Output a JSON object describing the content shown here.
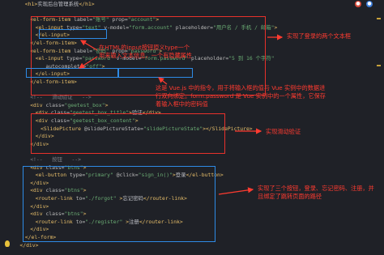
{
  "editor": {
    "lines": [
      {
        "indent": 4,
        "parts": [
          [
            "tag",
            "<h1>"
          ],
          [
            "punc",
            "实现后台管理系统"
          ],
          [
            "tag",
            "</h1>"
          ]
        ]
      },
      {
        "indent": 0,
        "parts": []
      },
      {
        "indent": 6,
        "parts": [
          [
            "tag",
            "<el-form-item "
          ],
          [
            "attr",
            "label="
          ],
          [
            "val",
            "\"账号\""
          ],
          [
            "attr",
            " prop="
          ],
          [
            "val",
            "\"account\""
          ],
          [
            "tag",
            ">"
          ]
        ]
      },
      {
        "indent": 8,
        "parts": [
          [
            "tag",
            "<el-input "
          ],
          [
            "attr",
            "type="
          ],
          [
            "val",
            "\"text\""
          ],
          [
            "attr",
            " v-model="
          ],
          [
            "val",
            "\"form.account\""
          ],
          [
            "attr",
            " placeholder="
          ],
          [
            "val",
            "\"用户名 / 手机 / 邮箱\""
          ],
          [
            "tag",
            ">"
          ]
        ]
      },
      {
        "indent": 8,
        "parts": [
          [
            "tag",
            "</el-input>"
          ]
        ]
      },
      {
        "indent": 6,
        "parts": [
          [
            "tag",
            "</el-form-item>"
          ]
        ]
      },
      {
        "indent": 6,
        "parts": [
          [
            "tag",
            "<el-form-item "
          ],
          [
            "attr",
            "label="
          ],
          [
            "val",
            "\"密码\""
          ],
          [
            "attr",
            " prop="
          ],
          [
            "val",
            "\"password\""
          ],
          [
            "tag",
            ">"
          ]
        ]
      },
      {
        "indent": 8,
        "parts": [
          [
            "tag",
            "<el-input "
          ],
          [
            "attr",
            "type="
          ],
          [
            "val",
            "\"password\""
          ],
          [
            "attr",
            " v-model="
          ],
          [
            "val",
            "\"form.password\""
          ],
          [
            "attr",
            " placeholder="
          ],
          [
            "val",
            "\"5 到 16 个字符\""
          ]
        ]
      },
      {
        "indent": 12,
        "parts": [
          [
            "attr",
            "autocomplete="
          ],
          [
            "val",
            "\"off\""
          ],
          [
            "tag",
            ">"
          ]
        ]
      },
      {
        "indent": 8,
        "parts": [
          [
            "tag",
            "</el-input>"
          ]
        ]
      },
      {
        "indent": 6,
        "parts": [
          [
            "tag",
            "</el-form-item>"
          ]
        ]
      },
      {
        "indent": 0,
        "parts": []
      },
      {
        "indent": 6,
        "parts": [
          [
            "cmt",
            "<!--   滑动验证   -->"
          ]
        ]
      },
      {
        "indent": 6,
        "parts": [
          [
            "tag",
            "<div "
          ],
          [
            "attr",
            "class="
          ],
          [
            "val",
            "\"geetest_box\""
          ],
          [
            "tag",
            ">"
          ]
        ]
      },
      {
        "indent": 8,
        "parts": [
          [
            "tag",
            "<div "
          ],
          [
            "attr",
            "class="
          ],
          [
            "val",
            "\"geetest_box_title\""
          ],
          [
            "tag",
            ">"
          ],
          [
            "punc",
            "验证"
          ],
          [
            "tag",
            "</div>"
          ]
        ]
      },
      {
        "indent": 8,
        "parts": [
          [
            "tag",
            "<div "
          ],
          [
            "attr",
            "class="
          ],
          [
            "val",
            "\"geetest_box_content\""
          ],
          [
            "tag",
            ">"
          ]
        ]
      },
      {
        "indent": 10,
        "parts": [
          [
            "tag",
            "<SlidePicture "
          ],
          [
            "attr",
            "@slidePictureState="
          ],
          [
            "val",
            "\"slidePictureState\""
          ],
          [
            "tag",
            "></SlidePicture>"
          ]
        ]
      },
      {
        "indent": 8,
        "parts": [
          [
            "tag",
            "</div>"
          ]
        ]
      },
      {
        "indent": 6,
        "parts": [
          [
            "tag",
            "</div>"
          ]
        ]
      },
      {
        "indent": 0,
        "parts": []
      },
      {
        "indent": 6,
        "parts": [
          [
            "cmt",
            "<!--   按钮   -->"
          ]
        ]
      },
      {
        "indent": 6,
        "parts": [
          [
            "tag",
            "<div "
          ],
          [
            "attr",
            "class="
          ],
          [
            "val",
            "\"btns\""
          ],
          [
            "tag",
            ">"
          ]
        ]
      },
      {
        "indent": 8,
        "parts": [
          [
            "tag",
            "<el-button "
          ],
          [
            "attr",
            "type="
          ],
          [
            "val",
            "\"primary\""
          ],
          [
            "attr",
            " @click="
          ],
          [
            "val",
            "\"sign_in()\""
          ],
          [
            "tag",
            ">"
          ],
          [
            "punc",
            "登录"
          ],
          [
            "tag",
            "</el-button>"
          ]
        ]
      },
      {
        "indent": 6,
        "parts": [
          [
            "tag",
            "</div>"
          ]
        ]
      },
      {
        "indent": 6,
        "parts": [
          [
            "tag",
            "<div "
          ],
          [
            "attr",
            "class="
          ],
          [
            "val",
            "\"btns\""
          ],
          [
            "tag",
            ">"
          ]
        ]
      },
      {
        "indent": 8,
        "parts": [
          [
            "tag",
            "<router-link "
          ],
          [
            "attr",
            "to="
          ],
          [
            "val",
            "\"./forgot\""
          ],
          [
            "tag",
            " >"
          ],
          [
            "punc",
            "忘记密码"
          ],
          [
            "tag",
            "</router-link>"
          ]
        ]
      },
      {
        "indent": 6,
        "parts": [
          [
            "tag",
            "</div>"
          ]
        ]
      },
      {
        "indent": 6,
        "parts": [
          [
            "tag",
            "<div "
          ],
          [
            "attr",
            "class="
          ],
          [
            "val",
            "\"btns\""
          ],
          [
            "tag",
            ">"
          ]
        ]
      },
      {
        "indent": 8,
        "parts": [
          [
            "tag",
            "<router-link "
          ],
          [
            "attr",
            "to="
          ],
          [
            "val",
            "\"./register\""
          ],
          [
            "tag",
            " >"
          ],
          [
            "punc",
            "注册"
          ],
          [
            "tag",
            "</router-link>"
          ]
        ]
      },
      {
        "indent": 6,
        "parts": [
          [
            "tag",
            "</div>"
          ]
        ]
      },
      {
        "indent": 4,
        "parts": [
          [
            "tag",
            "</el-form>"
          ]
        ]
      },
      {
        "indent": 2,
        "parts": [
          [
            "tag",
            "</div>"
          ]
        ]
      }
    ]
  },
  "annotations": {
    "login_boxes": "实现了登录的两个文本框",
    "input_type": "在HTML的input按钮原义type一个用来输入文本信息，一个有隐藏属性",
    "vmodel": "这是 Vue.js 中的指令，用于将输入框的值与 Vue 实例中的数据进行双向绑定。form.password 是 Vue 实例中的一个属性，它保存着输入框中的密码值",
    "slide_verify": "实现滑动验证",
    "buttons": "实现了三个按钮，登录、忘记密码、注册，并且绑定了跳转页面的路径"
  },
  "colors": {
    "background": "#1f2127",
    "tag": "#e8bf6a",
    "string": "#6aab73",
    "annotation": "#ff3b30",
    "red_box": "#e8312b",
    "blue_box": "#2e8be6"
  }
}
